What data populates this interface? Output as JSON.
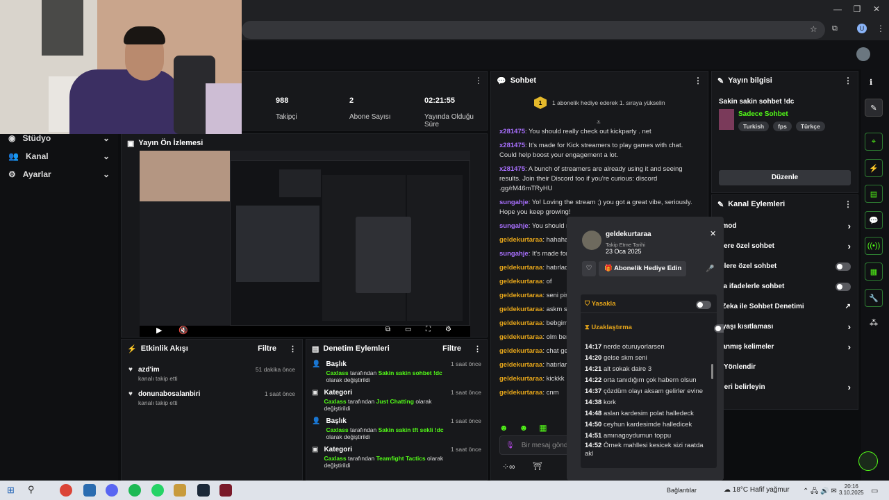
{
  "sidebar": {
    "items": [
      {
        "label": "Stüdyo"
      },
      {
        "label": "Kanal"
      },
      {
        "label": "Ayarlar"
      }
    ]
  },
  "stats": [
    {
      "value": "988",
      "label": "Takipçi"
    },
    {
      "value": "2",
      "label": "Abone Sayısı"
    },
    {
      "value": "02:21:55",
      "label": "Yayında Olduğu Süre"
    }
  ],
  "preview": {
    "title": "Yayın Ön İzlemesi"
  },
  "chat": {
    "title": "Sohbet",
    "banner_rank": "1",
    "banner_text": "1 abonelik hediye ederek 1. sıraya yükselin",
    "messages": [
      {
        "user": "x281475",
        "text": "You should really check out kickparty . net",
        "color": "purple"
      },
      {
        "user": "x281475",
        "text": "It's made for Kick streamers to play games with chat. Could help boost your engagement a lot.",
        "color": "purple"
      },
      {
        "user": "x281475",
        "text": "A bunch of streamers are already using it and seeing results. Join their Discord too if you're curious: discord .gg/rM46mTRyHU",
        "color": "purple"
      },
      {
        "user": "sungahje",
        "text": "Yo! Loving the stream ;) you got a great vibe, seriously. Hope you keep growing!",
        "color": "purple"
      },
      {
        "user": "sungahje",
        "text": "You should re",
        "color": "purple"
      },
      {
        "user": "geldekurtaraa",
        "text": "hahaha",
        "color": "orange"
      },
      {
        "user": "sungahje",
        "text": "It's made for Could help boost your e",
        "color": "purple"
      },
      {
        "user": "geldekurtaraa",
        "text": "hatırlad",
        "color": "orange"
      },
      {
        "user": "geldekurtaraa",
        "text": "of",
        "color": "orange"
      },
      {
        "user": "geldekurtaraa",
        "text": "seni pis",
        "color": "orange"
      },
      {
        "user": "geldekurtaraa",
        "text": "askm sa",
        "color": "orange"
      },
      {
        "user": "geldekurtaraa",
        "text": "bebgim",
        "color": "orange"
      },
      {
        "user": "geldekurtaraa",
        "text": "olm ben",
        "color": "orange"
      },
      {
        "user": "geldekurtaraa",
        "text": "chat ge",
        "color": "orange"
      },
      {
        "user": "geldekurtaraa",
        "text": "hatırlars",
        "color": "orange"
      },
      {
        "user": "geldekurtaraa",
        "text": "kickkk",
        "color": "orange"
      },
      {
        "user": "geldekurtaraa",
        "text": "cnm",
        "color": "orange"
      }
    ],
    "input_placeholder": "Bir mesaj gönd"
  },
  "info": {
    "title": "Yayın bilgisi",
    "stream_title": "Sakin sakin sohbet !dc",
    "mode": "Sadece Sohbet",
    "tags": [
      "Turkish",
      "fps",
      "Türkçe"
    ],
    "edit": "Düzenle"
  },
  "actions": {
    "title": "Kanal Eylemleri",
    "items": [
      {
        "label": "ş mod",
        "kind": "chev"
      },
      {
        "label": "çilere özel sohbet",
        "kind": "chev"
      },
      {
        "label": "nelere özel sohbet",
        "kind": "toggle"
      },
      {
        "label": "zca ifadelerle sohbet",
        "kind": "toggle"
      },
      {
        "label": "y Zeka ile Sohbet Denetimi",
        "kind": "ext"
      },
      {
        "label": "p yaşı kısıtlaması",
        "kind": "chev"
      },
      {
        "label": "klanmış kelimeler",
        "kind": "chev"
      },
      {
        "label": "ci Yönlendir",
        "kind": "none"
      },
      {
        "label": "efleri belirleyin",
        "kind": "chev"
      }
    ]
  },
  "events": {
    "title": "Etkinlik Akışı",
    "filter": "Filtre",
    "items": [
      {
        "name": "azd'im",
        "sub": "kanalı takip etti",
        "time": "51 dakika önce"
      },
      {
        "name": "donunabosalanbiri",
        "sub": "kanalı takip etti",
        "time": "1 saat önce"
      }
    ]
  },
  "moderation": {
    "title": "Denetim Eylemleri",
    "filter": "Filtre",
    "items": [
      {
        "kind": "Başlık",
        "actor": "Caxlass",
        "mid": "tarafından",
        "value": "Sakin sakin sohbet !dc",
        "tail": "olarak değiştirildi",
        "time": "1 saat önce"
      },
      {
        "kind": "Kategori",
        "actor": "Caxlass",
        "mid": "tarafından",
        "value": "Just Chatting",
        "tail": "olarak değiştirildi",
        "time": "1 saat önce"
      },
      {
        "kind": "Başlık",
        "actor": "Caxlass",
        "mid": "tarafından",
        "value": "Sakin sakin tft sekli !dc",
        "tail": "olarak değiştirildi",
        "time": "1 saat önce"
      },
      {
        "kind": "Kategori",
        "actor": "Caxlass",
        "mid": "tarafından",
        "value": "Teamfight Tactics",
        "tail": "olarak değiştirildi",
        "time": "1 saat önce"
      }
    ]
  },
  "usercard": {
    "username": "geldekurtaraa",
    "follow_label": "Takip Etme Tarihi",
    "follow_date": "23 Oca 2025",
    "gift": "Abonelik Hediye Edin",
    "ban": "Yasakla",
    "timeout": "Uzaklaştırma",
    "history": [
      {
        "t": "14:17",
        "m": "nerde oturuyorlarsen"
      },
      {
        "t": "14:20",
        "m": "gelse skm seni"
      },
      {
        "t": "14:21",
        "m": "alt sokak daire 3"
      },
      {
        "t": "14:22",
        "m": "orta tanıdığım çok habern olsun"
      },
      {
        "t": "14:37",
        "m": "çözdüm olayı aksam gelirler evine"
      },
      {
        "t": "14:38",
        "m": "kork"
      },
      {
        "t": "14:48",
        "m": "aslan kardesim polat halledeck"
      },
      {
        "t": "14:50",
        "m": "ceyhun kardesimde halledicek"
      },
      {
        "t": "14:51",
        "m": "amınagoydumun toppu"
      },
      {
        "t": "14:52",
        "m": "Örnek mahllesi kesicek sizi raatda akl"
      }
    ]
  },
  "taskbar": {
    "network": "Bağlantılar",
    "weather": "18°C  Hafif yağmur",
    "time": "20:16",
    "date": "3.10.2025"
  },
  "colors": {
    "kick_green": "#53fc18",
    "panel": "#17181b",
    "bg": "#0c0d0f"
  }
}
